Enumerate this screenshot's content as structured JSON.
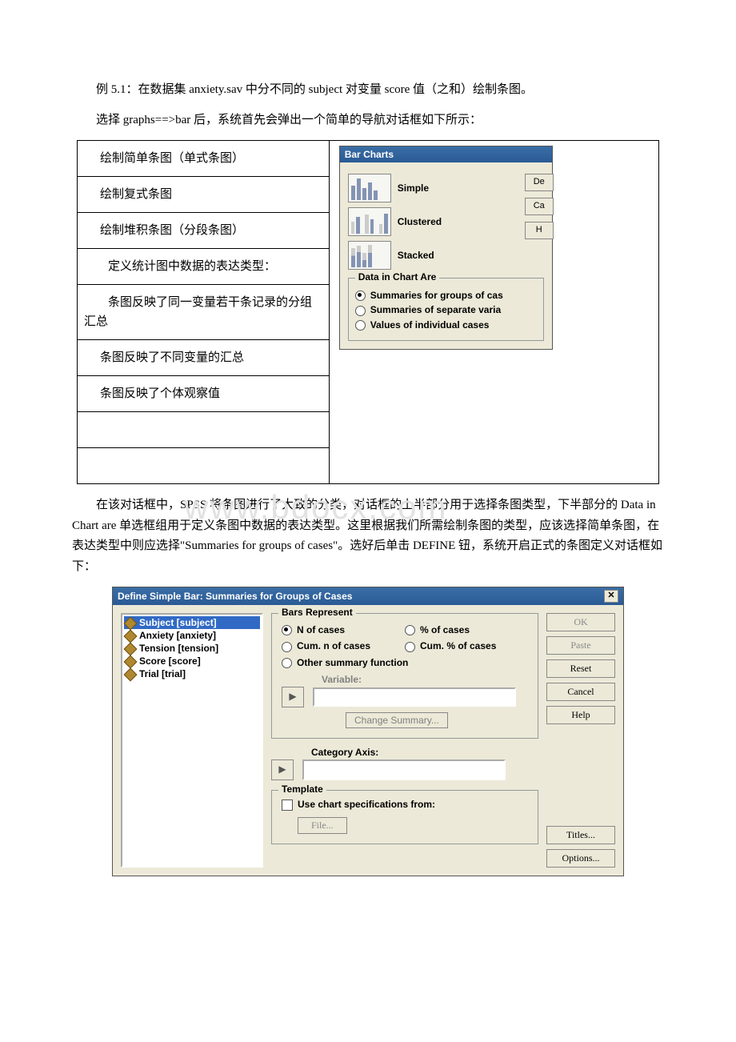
{
  "intro": {
    "p1": "例 5.1：在数据集 anxiety.sav 中分不同的 subject 对变量 score 值（之和）绘制条图。",
    "p2": "选择 graphs==>bar 后，系统首先会弹出一个简单的导航对话框如下所示："
  },
  "watermark": "www.bdocx.com",
  "fig1": {
    "left_rows": [
      "绘制简单条图（单式条图）",
      "绘制复式条图",
      "绘制堆积条图（分段条图）",
      "定义统计图中数据的表达类型：",
      "条图反映了同一变量若干条记录的分组汇总",
      "条图反映了不同变量的汇总",
      "条图反映了个体观察值"
    ],
    "dlg_title": "Bar Charts",
    "opt_simple": "Simple",
    "opt_clustered": "Clustered",
    "opt_stacked": "Stacked",
    "rbtn1": "De",
    "rbtn2": "Ca",
    "rbtn3": "H",
    "group_title": "Data in Chart Are",
    "radio1": "Summaries for groups of cas",
    "radio2": "Summaries of separate varia",
    "radio3": "Values of individual cases"
  },
  "mid": {
    "p1": "在该对话框中，SPSS 将条图进行了大致的分类，对话框的上半部分用于选择条图类型，下半部分的 Data in Chart are 单选框组用于定义条图中数据的表达类型。这里根据我们所需绘制条图的类型，应该选择简单条图，在表达类型中则应选择\"Summaries for groups of cases\"。选好后单击 DEFINE 钮，系统开启正式的条图定义对话框如下："
  },
  "dlg2": {
    "title": "Define Simple Bar: Summaries for Groups of Cases",
    "vars": [
      "Subject [subject]",
      "Anxiety [anxiety]",
      "Tension [tension]",
      "Score [score]",
      "Trial [trial]"
    ],
    "bars_represent": "Bars Represent",
    "r_n": "N of cases",
    "r_pct": "% of cases",
    "r_cumn": "Cum. n of cases",
    "r_cumpct": "Cum. % of cases",
    "r_other": "Other summary function",
    "variable_lbl": "Variable:",
    "change_summary": "Change Summary...",
    "category_axis": "Category Axis:",
    "template": "Template",
    "use_spec": "Use chart specifications from:",
    "file_btn": "File...",
    "btn_ok": "OK",
    "btn_paste": "Paste",
    "btn_reset": "Reset",
    "btn_cancel": "Cancel",
    "btn_help": "Help",
    "btn_titles": "Titles...",
    "btn_options": "Options..."
  }
}
